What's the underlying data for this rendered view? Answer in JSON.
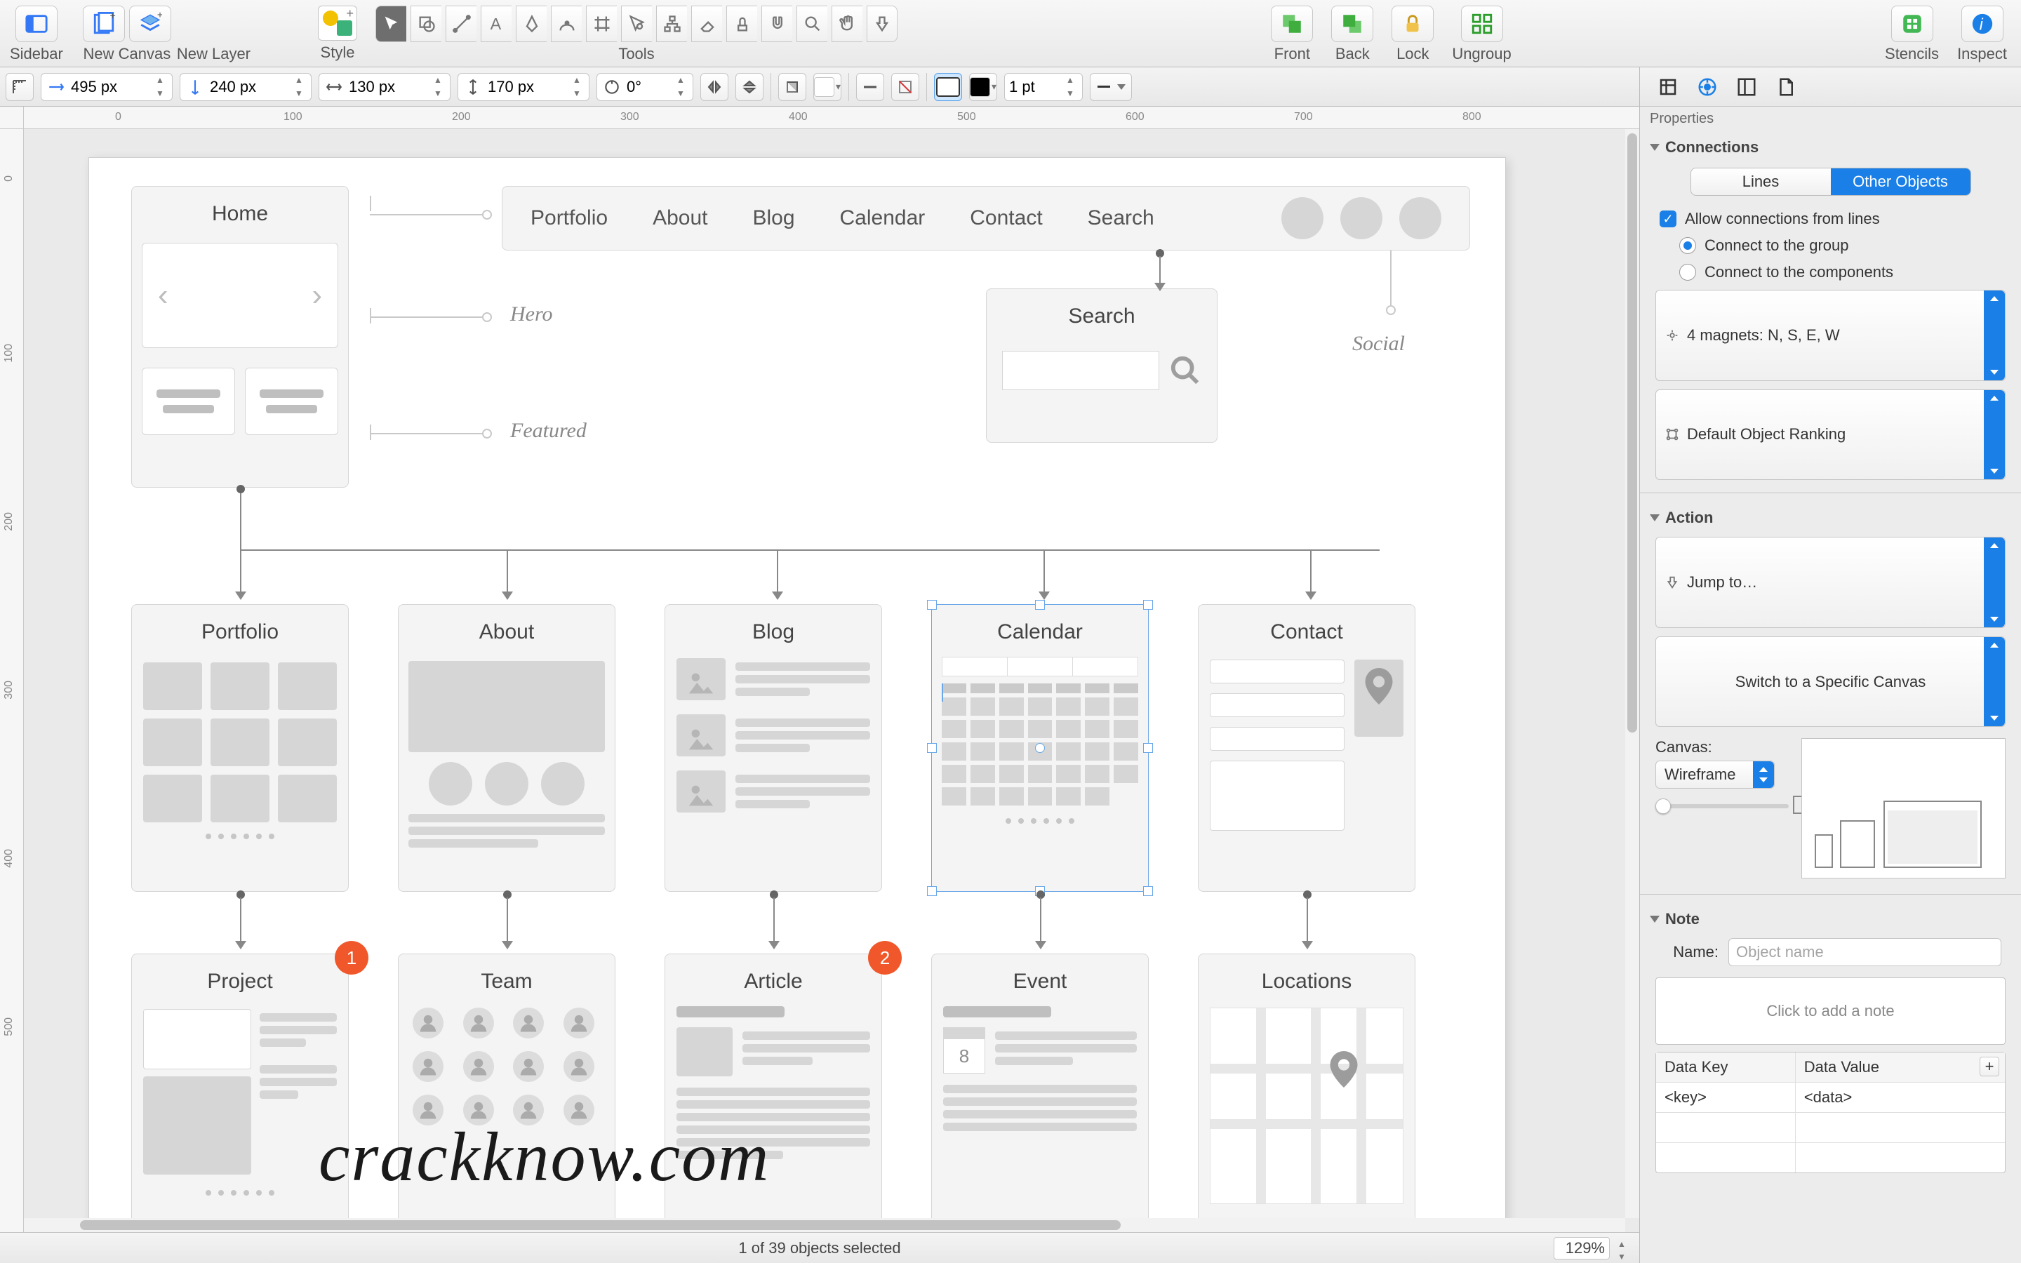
{
  "toolbar": {
    "sidebar": "Sidebar",
    "new_canvas": "New Canvas",
    "new_layer": "New Layer",
    "style": "Style",
    "tools": "Tools",
    "front": "Front",
    "back": "Back",
    "lock": "Lock",
    "ungroup": "Ungroup",
    "stencils": "Stencils",
    "inspect": "Inspect"
  },
  "optbar": {
    "x": "495 px",
    "y": "240 px",
    "w": "130 px",
    "h": "170 px",
    "rot": "0°",
    "stroke_pt": "1 pt"
  },
  "statusbar": {
    "selection": "1 of 39 objects selected",
    "zoom": "129%"
  },
  "canvas": {
    "nav_items": [
      "Portfolio",
      "About",
      "Blog",
      "Calendar",
      "Contact",
      "Search"
    ],
    "home": "Home",
    "hero": "Hero",
    "featured": "Featured",
    "social": "Social",
    "search_card": "Search",
    "row1": [
      "Portfolio",
      "About",
      "Blog",
      "Calendar",
      "Contact"
    ],
    "row2": [
      "Project",
      "Team",
      "Article",
      "Event",
      "Locations"
    ],
    "badge1": "1",
    "badge2": "2",
    "event_day": "8",
    "ruler_h": [
      "0",
      "100",
      "200",
      "300",
      "400",
      "500",
      "600",
      "700",
      "800"
    ],
    "ruler_v": [
      "0",
      "100",
      "200",
      "300",
      "400",
      "500"
    ]
  },
  "inspector": {
    "properties": "Properties",
    "connections": "Connections",
    "seg_lines": "Lines",
    "seg_other": "Other Objects",
    "allow": "Allow connections from lines",
    "conn_group": "Connect to the group",
    "conn_components": "Connect to the components",
    "magnets": "4 magnets: N, S, E, W",
    "ranking": "Default Object Ranking",
    "action": "Action",
    "jump": "Jump to…",
    "switch": "Switch to a Specific Canvas",
    "canvas_label": "Canvas:",
    "canvas_name": "Wireframe",
    "note": "Note",
    "name_label": "Name:",
    "name_placeholder": "Object name",
    "note_placeholder": "Click to add a note",
    "kv_key_h": "Data Key",
    "kv_val_h": "Data Value",
    "kv_key": "<key>",
    "kv_val": "<data>"
  },
  "watermark": "crackknow.com"
}
